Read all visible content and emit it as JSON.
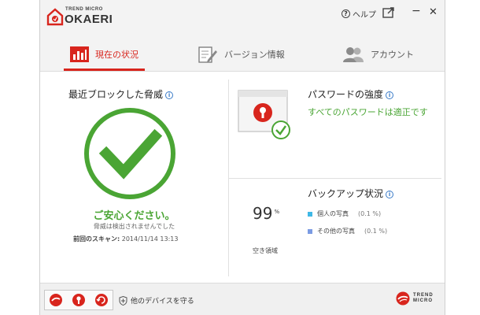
{
  "app": {
    "brand_small": "TREND MICRO",
    "brand": "OKAERI"
  },
  "titlebar": {
    "help_label": "ヘルプ",
    "minimize_symbol": "−",
    "close_symbol": "✕"
  },
  "tabs": [
    {
      "label": "現在の状況",
      "icon": "bar-chart-icon",
      "active": true
    },
    {
      "label": "バージョン情報",
      "icon": "document-pen-icon",
      "active": false
    },
    {
      "label": "アカウント",
      "icon": "users-icon",
      "active": false
    }
  ],
  "threats": {
    "title": "最近ブロックした脅威",
    "status": "ご安心ください。",
    "sub": "脅威は検出されませんでした",
    "last_scan_label": "前回のスキャン:",
    "last_scan_value": "2014/11/14 13:13"
  },
  "password": {
    "title": "パスワードの強度",
    "status": "すべてのパスワードは適正です"
  },
  "backup": {
    "title": "バックアップ状況",
    "percent": "99",
    "percent_unit": "%",
    "free_label": "空き領域",
    "items": [
      {
        "label": "個人の写真",
        "value": "(0.1 %)",
        "color": "#3fb8e6"
      },
      {
        "label": "その他の写真",
        "value": "(0.1 %)",
        "color": "#7b9be3"
      }
    ]
  },
  "footer": {
    "protect_label": "他のデバイスを守る",
    "logo_line1": "TREND",
    "logo_line2": "MICRO"
  },
  "colors": {
    "accent": "#d8251d",
    "safe_green": "#4aa534",
    "info_blue": "#3a7bc8"
  }
}
